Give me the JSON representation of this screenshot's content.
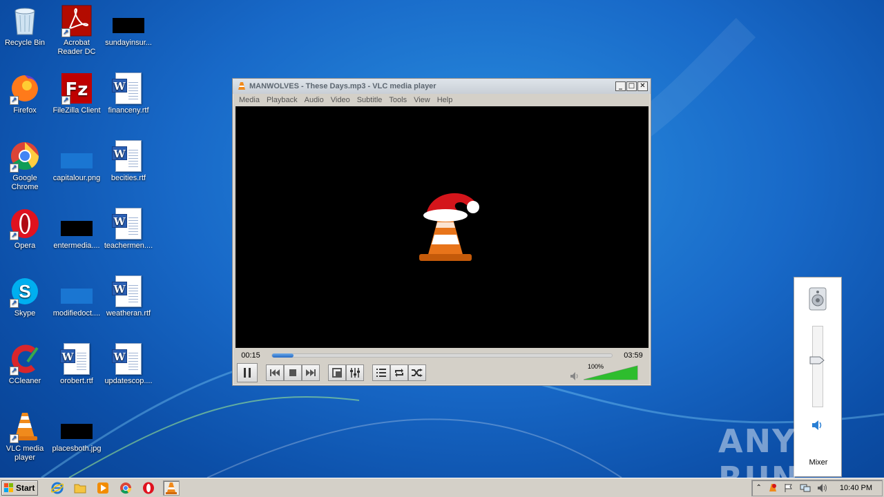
{
  "desktop": {
    "icons": [
      {
        "label": "Recycle Bin",
        "icon": "recycle-bin-icon"
      },
      {
        "label": "Acrobat Reader DC",
        "icon": "acrobat-icon"
      },
      {
        "label": "sundayinsur...",
        "icon": "black-image-icon"
      },
      {
        "label": "Firefox",
        "icon": "firefox-icon"
      },
      {
        "label": "FileZilla Client",
        "icon": "filezilla-icon"
      },
      {
        "label": "financeny.rtf",
        "icon": "word-doc-icon"
      },
      {
        "label": "Google Chrome",
        "icon": "chrome-icon"
      },
      {
        "label": "capitalour.png",
        "icon": "blue-image-icon"
      },
      {
        "label": "becities.rtf",
        "icon": "word-doc-icon"
      },
      {
        "label": "Opera",
        "icon": "opera-icon"
      },
      {
        "label": "entermedia....",
        "icon": "black-image-icon"
      },
      {
        "label": "teachermen....",
        "icon": "word-doc-icon"
      },
      {
        "label": "Skype",
        "icon": "skype-icon"
      },
      {
        "label": "modifiedoct....",
        "icon": "blue-image-icon"
      },
      {
        "label": "weatheran.rtf",
        "icon": "word-doc-icon"
      },
      {
        "label": "CCleaner",
        "icon": "ccleaner-icon"
      },
      {
        "label": "orobert.rtf",
        "icon": "word-doc-icon"
      },
      {
        "label": "updatescop....",
        "icon": "word-doc-icon"
      },
      {
        "label": "VLC media player",
        "icon": "vlc-icon"
      },
      {
        "label": "placesboth.jpg",
        "icon": "black-image-icon"
      }
    ]
  },
  "vlc": {
    "title": "MANWOLVES - These Days.mp3 - VLC media player",
    "window_buttons": {
      "minimize": "_",
      "maximize": "□",
      "close": "✕"
    },
    "menu": [
      "Media",
      "Playback",
      "Audio",
      "Video",
      "Subtitle",
      "Tools",
      "View",
      "Help"
    ],
    "elapsed": "00:15",
    "duration": "03:59",
    "progress_fraction": 0.063,
    "volume_label": "100%",
    "volume_fraction": 1.0
  },
  "mixer": {
    "label": "Mixer",
    "level_fraction": 0.6
  },
  "watermark": "ANY RUN",
  "taskbar": {
    "start_label": "Start",
    "pinned": [
      "internet-explorer-icon",
      "explorer-folder-icon",
      "media-player-icon",
      "chrome-icon",
      "opera-icon",
      "vlc-icon"
    ],
    "clock": "10:40 PM"
  },
  "colors": {
    "vlc_orange": "#f08a1c",
    "wallpaper_blue": "#1869c8",
    "volume_green": "#2ebd2e"
  }
}
